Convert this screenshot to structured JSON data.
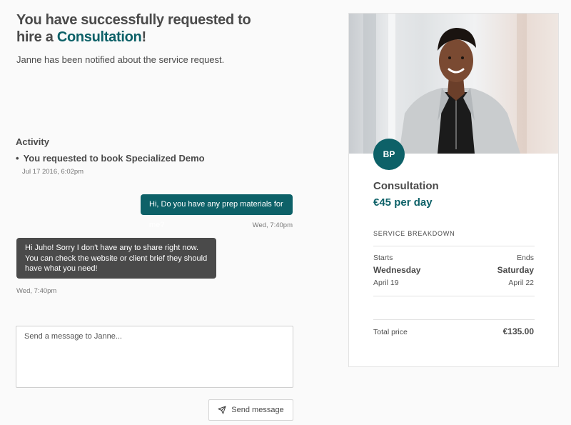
{
  "header": {
    "title_prefix": "You have successfully requested to hire a ",
    "title_accent": "Consultation",
    "title_suffix": "!",
    "subtitle": "Janne has been notified about the service request."
  },
  "activity": {
    "heading": "Activity",
    "items": [
      {
        "text": "You requested to book Specialized Demo",
        "time": "Jul 17 2016, 6:02pm"
      }
    ]
  },
  "messages": [
    {
      "direction": "outgoing",
      "text": "Hi, Do you have any prep materials for me?",
      "time": "Wed, 7:40pm"
    },
    {
      "direction": "incoming",
      "text": "Hi Juho! Sorry I don't have any to share right now. You can check the website or client brief they should have what you need!",
      "time": "Wed, 7:40pm"
    }
  ],
  "composer": {
    "placeholder": "Send a message to Janne...",
    "send_label": "Send message",
    "send_icon": "paper-plane-icon"
  },
  "listing": {
    "avatar_initials": "BP",
    "title": "Consultation",
    "price": "€45 per day",
    "breakdown_label": "SERVICE BREAKDOWN",
    "starts_label": "Starts",
    "ends_label": "Ends",
    "start_day": "Wednesday",
    "end_day": "Saturday",
    "start_date": "April 19",
    "end_date": "April 22",
    "total_label": "Total price",
    "total_value": "€135.00"
  },
  "colors": {
    "accent": "#0d6168",
    "incoming_bubble": "#4a4a4a",
    "background": "#fafafa"
  }
}
